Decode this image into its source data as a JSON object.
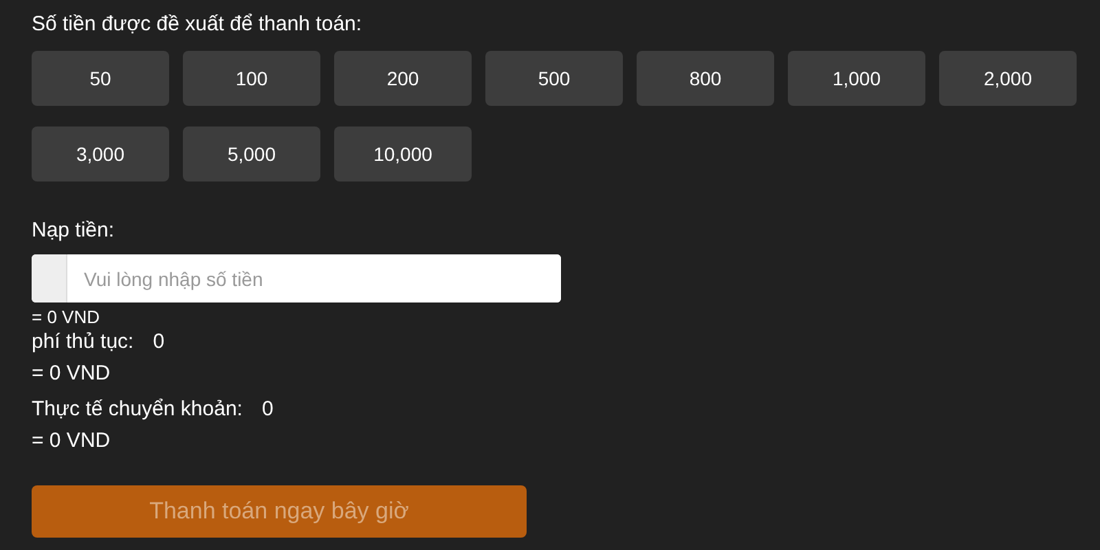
{
  "amounts_label": "Số tiền được đề xuất để thanh toán:",
  "amounts": [
    "50",
    "100",
    "200",
    "500",
    "800",
    "1,000",
    "2,000",
    "3,000",
    "5,000",
    "10,000"
  ],
  "deposit_label": "Nạp tiền:",
  "deposit_field": {
    "placeholder": "Vui lòng nhập số tiền"
  },
  "deposit_converted": "= 0 VND",
  "fee": {
    "label": "phí thủ tục:",
    "value": "0",
    "converted": "= 0 VND"
  },
  "actual": {
    "label": "Thực tế chuyển khoản:",
    "value": "0",
    "converted": "= 0 VND"
  },
  "pay_button": {
    "label": "Thanh toán ngay bây giờ",
    "disabled": true
  }
}
